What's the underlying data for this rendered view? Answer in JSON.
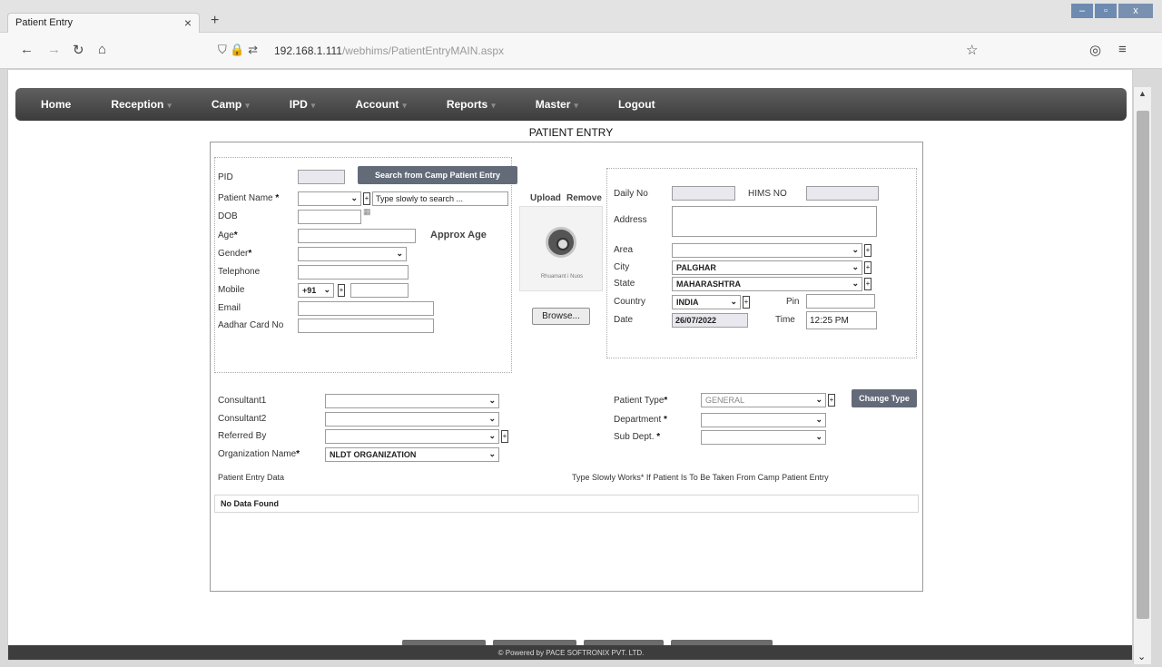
{
  "browser": {
    "tab_title": "Patient Entry",
    "tab_close": "×",
    "new_tab": "+",
    "url_host": "192.168.1.111",
    "url_path": "/webhims/PatientEntryMAIN.aspx",
    "win_min": "–",
    "win_max": "▫",
    "win_close": "x"
  },
  "menu": [
    "Home",
    "Reception",
    "Camp",
    "IPD",
    "Account",
    "Reports",
    "Master",
    "Logout"
  ],
  "page_title": "PATIENT ENTRY",
  "left_form": {
    "pid_label": "PID",
    "search_camp_button": "Search from Camp Patient Entry",
    "patient_name_label": "Patient Name",
    "name_search_placeholder": "Type slowly to search ...",
    "dob_label": "DOB",
    "age_label": "Age",
    "approx_age": "Approx Age",
    "gender_label": "Gender",
    "telephone_label": "Telephone",
    "mobile_label": "Mobile",
    "mobile_code": "+91",
    "email_label": "Email",
    "aadhar_label": "Aadhar Card No"
  },
  "photo": {
    "upload": "Upload",
    "remove": "Remove",
    "caption": "Rhuamant i Nuos",
    "browse_button": "Browse..."
  },
  "right_form": {
    "daily_no_label": "Daily No",
    "hims_no_label": "HIMS NO",
    "address_label": "Address",
    "area_label": "Area",
    "city_label": "City",
    "city_value": "PALGHAR",
    "state_label": "State",
    "state_value": "MAHARASHTRA",
    "country_label": "Country",
    "country_value": "INDIA",
    "pin_label": "Pin",
    "date_label": "Date",
    "date_value": "26/07/2022",
    "time_label": "Time",
    "time_value": "12:25 PM"
  },
  "lower_form": {
    "consultant1_label": "Consultant1",
    "consultant2_label": "Consultant2",
    "referred_label": "Referred By",
    "org_label": "Organization Name",
    "org_value": "NLDT ORGANIZATION",
    "patient_type_label": "Patient Type",
    "patient_type_value": "GENERAL",
    "change_type_button": "Change Type",
    "department_label": "Department",
    "sub_dept_label": "Sub Dept.",
    "entry_data_label": "Patient Entry Data",
    "hint": "Type Slowly Works* If Patient Is To Be Taken From Camp Patient Entry",
    "no_data": "No Data Found"
  },
  "footer_text": "© Powered by PACE SOFTRONIX PVT. LTD.",
  "required_mark": "*"
}
